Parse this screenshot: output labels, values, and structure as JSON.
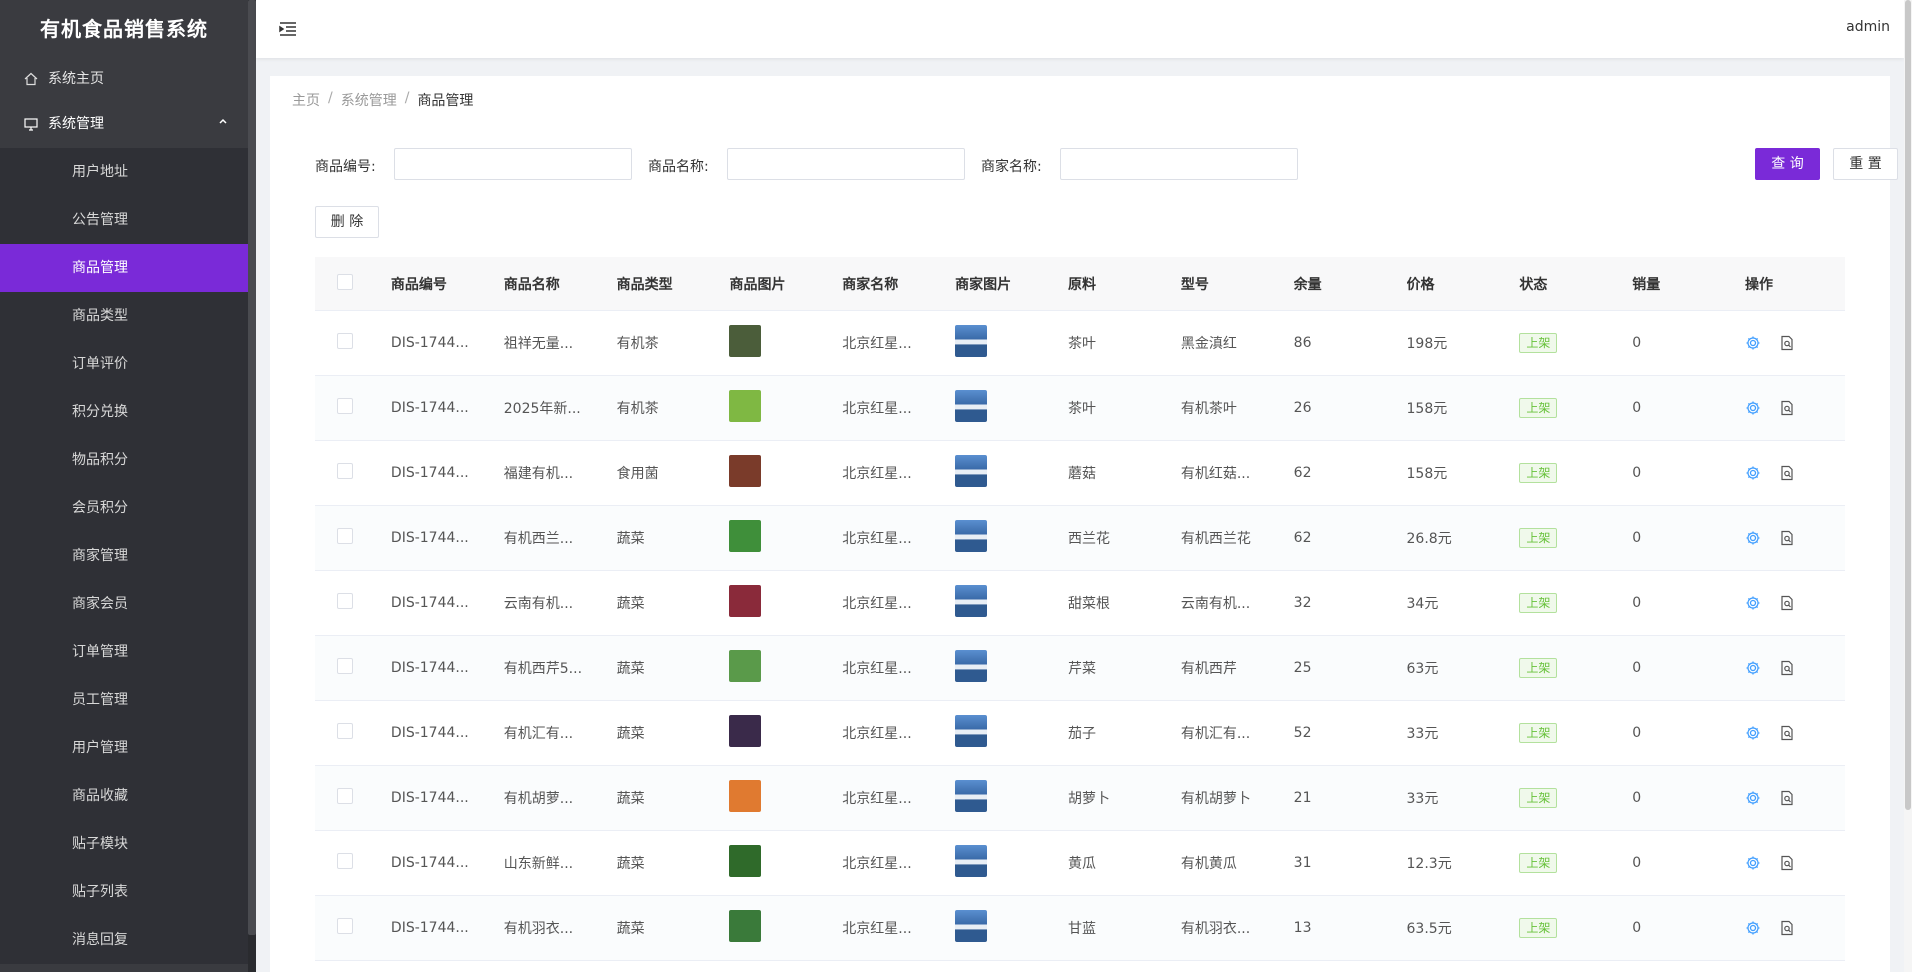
{
  "app_title": "有机食品销售系统",
  "user": "admin",
  "sidebar": {
    "home": "系统主页",
    "group": "系统管理",
    "items": [
      {
        "label": "用户地址",
        "active": false
      },
      {
        "label": "公告管理",
        "active": false
      },
      {
        "label": "商品管理",
        "active": true
      },
      {
        "label": "商品类型",
        "active": false
      },
      {
        "label": "订单评价",
        "active": false
      },
      {
        "label": "积分兑换",
        "active": false
      },
      {
        "label": "物品积分",
        "active": false
      },
      {
        "label": "会员积分",
        "active": false
      },
      {
        "label": "商家管理",
        "active": false
      },
      {
        "label": "商家会员",
        "active": false
      },
      {
        "label": "订单管理",
        "active": false
      },
      {
        "label": "员工管理",
        "active": false
      },
      {
        "label": "用户管理",
        "active": false
      },
      {
        "label": "商品收藏",
        "active": false
      },
      {
        "label": "贴子模块",
        "active": false
      },
      {
        "label": "贴子列表",
        "active": false
      },
      {
        "label": "消息回复",
        "active": false
      }
    ]
  },
  "breadcrumb": {
    "home": "主页",
    "section": "系统管理",
    "current": "商品管理"
  },
  "search": {
    "code_label": "商品编号:",
    "name_label": "商品名称:",
    "merchant_label": "商家名称:",
    "code_value": "",
    "name_value": "",
    "merchant_value": "",
    "query_button": "查 询",
    "reset_button": "重 置"
  },
  "delete_button": "删 除",
  "colors": {
    "primary": "#7a2ad8",
    "sidebar": "#3a3b40",
    "tag_green": "#67c23a",
    "icon_blue": "#409eff"
  },
  "table": {
    "columns": [
      "商品编号",
      "商品名称",
      "商品类型",
      "商品图片",
      "商家名称",
      "商家图片",
      "原料",
      "型号",
      "余量",
      "价格",
      "状态",
      "销量",
      "操作"
    ],
    "rows": [
      {
        "code": "DIS-1744...",
        "name": "祖祥无量...",
        "type": "有机茶",
        "merchant": "北京红星...",
        "material": "茶叶",
        "model": "黑金滇红",
        "stock": "86",
        "price": "198元",
        "status": "上架",
        "sales": "0",
        "img_color": "#4b5d3a"
      },
      {
        "code": "DIS-1744...",
        "name": "2025年新...",
        "type": "有机茶",
        "merchant": "北京红星...",
        "material": "茶叶",
        "model": "有机茶叶",
        "stock": "26",
        "price": "158元",
        "status": "上架",
        "sales": "0",
        "img_color": "#7fb843"
      },
      {
        "code": "DIS-1744...",
        "name": "福建有机...",
        "type": "食用菌",
        "merchant": "北京红星...",
        "material": "蘑菇",
        "model": "有机红菇...",
        "stock": "62",
        "price": "158元",
        "status": "上架",
        "sales": "0",
        "img_color": "#7a3b2a"
      },
      {
        "code": "DIS-1744...",
        "name": "有机西兰...",
        "type": "蔬菜",
        "merchant": "北京红星...",
        "material": "西兰花",
        "model": "有机西兰花",
        "stock": "62",
        "price": "26.8元",
        "status": "上架",
        "sales": "0",
        "img_color": "#3f8f3a"
      },
      {
        "code": "DIS-1744...",
        "name": "云南有机...",
        "type": "蔬菜",
        "merchant": "北京红星...",
        "material": "甜菜根",
        "model": "云南有机...",
        "stock": "32",
        "price": "34元",
        "status": "上架",
        "sales": "0",
        "img_color": "#8a2a3a"
      },
      {
        "code": "DIS-1744...",
        "name": "有机西芹5...",
        "type": "蔬菜",
        "merchant": "北京红星...",
        "material": "芹菜",
        "model": "有机西芹",
        "stock": "25",
        "price": "63元",
        "status": "上架",
        "sales": "0",
        "img_color": "#5a9a4a"
      },
      {
        "code": "DIS-1744...",
        "name": "有机汇有...",
        "type": "蔬菜",
        "merchant": "北京红星...",
        "material": "茄子",
        "model": "有机汇有...",
        "stock": "52",
        "price": "33元",
        "status": "上架",
        "sales": "0",
        "img_color": "#3a2a4a"
      },
      {
        "code": "DIS-1744...",
        "name": "有机胡萝...",
        "type": "蔬菜",
        "merchant": "北京红星...",
        "material": "胡萝卜",
        "model": "有机胡萝卜",
        "stock": "21",
        "price": "33元",
        "status": "上架",
        "sales": "0",
        "img_color": "#e07a30"
      },
      {
        "code": "DIS-1744...",
        "name": "山东新鲜...",
        "type": "蔬菜",
        "merchant": "北京红星...",
        "material": "黄瓜",
        "model": "有机黄瓜",
        "stock": "31",
        "price": "12.3元",
        "status": "上架",
        "sales": "0",
        "img_color": "#2f6a2a"
      },
      {
        "code": "DIS-1744...",
        "name": "有机羽衣...",
        "type": "蔬菜",
        "merchant": "北京红星...",
        "material": "甘蓝",
        "model": "有机羽衣...",
        "stock": "13",
        "price": "63.5元",
        "status": "上架",
        "sales": "0",
        "img_color": "#3a7a3a"
      }
    ]
  }
}
